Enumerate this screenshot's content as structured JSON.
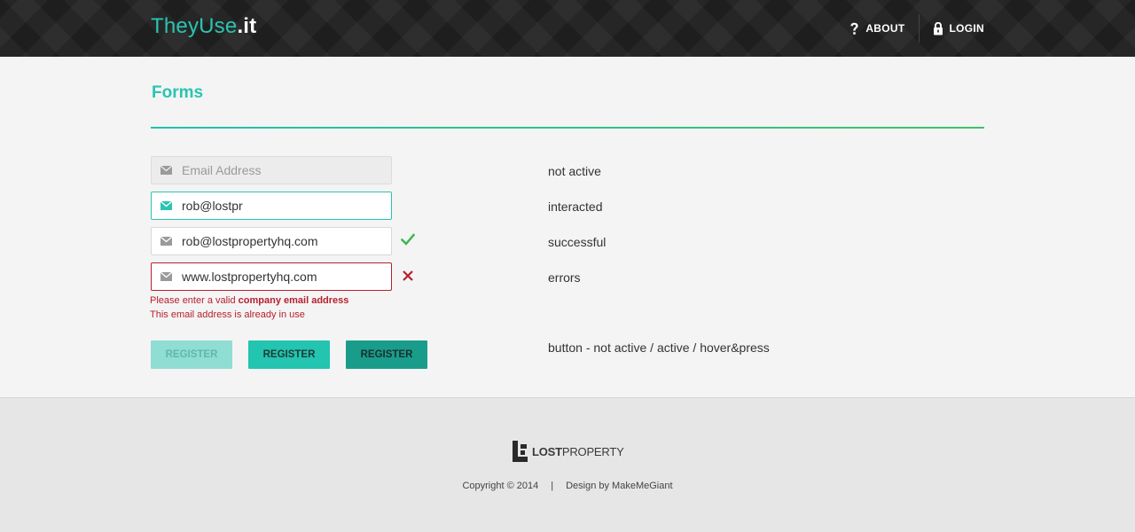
{
  "header": {
    "logo_part1": "TheyUse",
    "logo_part2": ".it",
    "nav": {
      "about": "ABOUT",
      "login": "LOGIN"
    }
  },
  "page": {
    "title": "Forms"
  },
  "fields": [
    {
      "placeholder": "Email Address",
      "value": "",
      "state": "not active"
    },
    {
      "value": "rob@lostpr",
      "state": "interacted"
    },
    {
      "value": "rob@lostpropertyhq.com",
      "state": "successful"
    },
    {
      "value": "www.lostpropertyhq.com",
      "state": "errors"
    }
  ],
  "errors": {
    "line1_prefix": "Please enter a valid ",
    "line1_bold": "company email address",
    "line2": "This email address is already in use"
  },
  "buttons": {
    "labels": [
      "REGISTER",
      "REGISTER",
      "REGISTER"
    ],
    "description": "button - not active / active / hover&press"
  },
  "footer": {
    "brand_bold": "LOST",
    "brand_rest": "PROPERTY",
    "copyright": "Copyright © 2014",
    "separator": "|",
    "design": "Design by MakeMeGiant"
  },
  "colors": {
    "accent": "#2bc4b0",
    "error": "#b7202e",
    "success": "#3cb550",
    "header_bg": "#1e1e1e"
  },
  "icons": [
    "question-icon",
    "lock-icon",
    "mail-icon",
    "checkmark-icon",
    "cross-icon",
    "lost-property-logo-icon"
  ]
}
